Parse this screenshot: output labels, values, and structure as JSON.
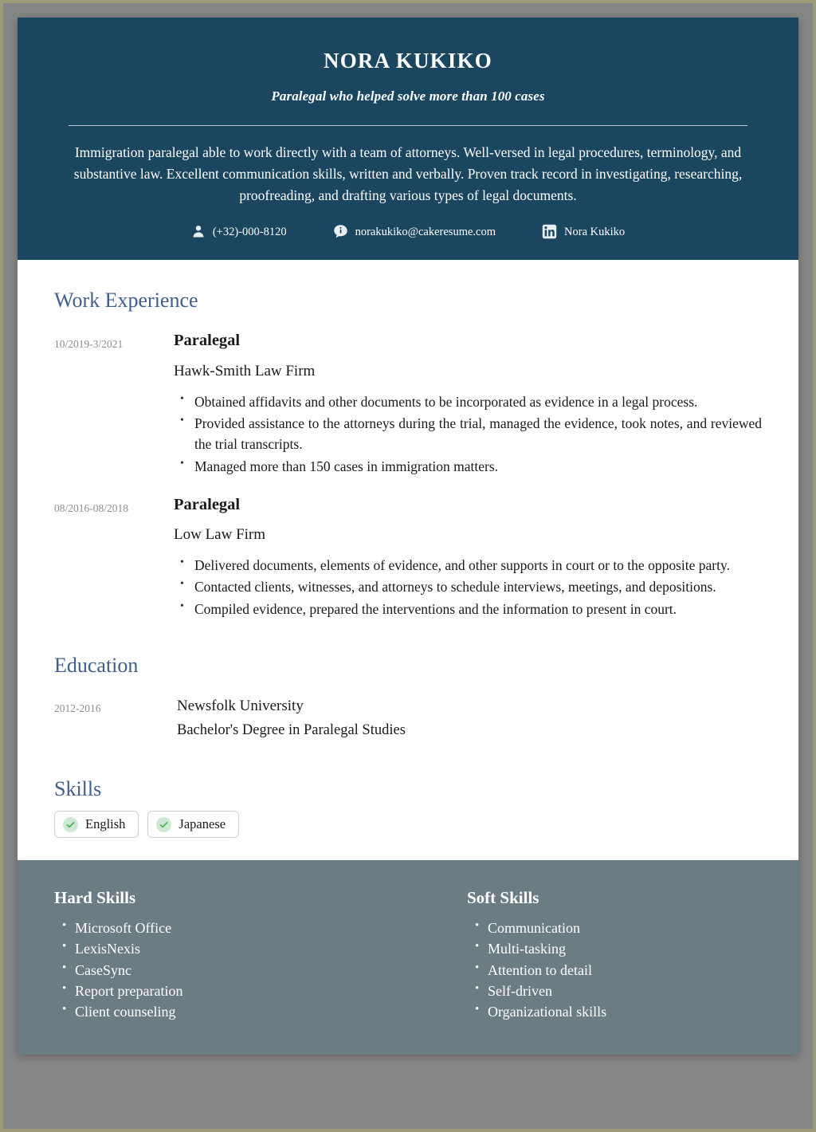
{
  "theme": {
    "header_bg": "#1b4660",
    "footer_bg": "#6c7c83",
    "page_bg": "#ffffff",
    "canvas_bg": "#868686",
    "frame": "#9d9a77",
    "heading_accent": "#3f5f8c",
    "date_text": "#8e8e8e",
    "check_circle_bg": "#cfe8d3",
    "check_mark": "#4caf50"
  },
  "header": {
    "full_name": "NORA KUKIKO",
    "tagline": "Paralegal who helped solve more than 100 cases",
    "summary": "Immigration paralegal able to work directly with a team of attorneys. Well-versed in legal procedures, terminology, and substantive law. Excellent communication skills, written and verbally. Proven track record in investigating, researching, proofreading, and drafting various types of legal documents.",
    "contacts": [
      {
        "icon": "person-icon",
        "label": "(+32)-000-8120"
      },
      {
        "icon": "info-bubble-icon",
        "label": "norakukiko@cakeresume.com"
      },
      {
        "icon": "linkedin-icon",
        "label": "Nora Kukiko"
      }
    ]
  },
  "work_experience": {
    "title": "Work Experience",
    "entries": [
      {
        "date": "10/2019-3/2021",
        "job_title": "Paralegal",
        "organization": "Hawk-Smith Law Firm",
        "duties": [
          "Obtained affidavits and other documents to be incorporated as evidence in a legal process.",
          "Provided assistance to the attorneys during the trial, managed the evidence, took notes, and reviewed the trial transcripts.",
          "Managed more than 150 cases in immigration matters."
        ]
      },
      {
        "date": "08/2016-08/2018",
        "job_title": "Paralegal",
        "organization": "Low Law Firm",
        "duties": [
          "Delivered documents, elements of evidence, and other supports in court or to the opposite party.",
          "Contacted clients, witnesses, and attorneys to schedule interviews, meetings, and depositions.",
          "Compiled evidence, prepared the interventions and the information to present in court."
        ]
      }
    ]
  },
  "education": {
    "title": "Education",
    "entries": [
      {
        "date": "2012-2016",
        "school": "Newsfolk University",
        "degree": "Bachelor's Degree in Paralegal Studies"
      }
    ]
  },
  "skills": {
    "title": "Skills",
    "items": [
      {
        "label": "English",
        "icon": "check-circle-icon"
      },
      {
        "label": "Japanese",
        "icon": "check-circle-icon"
      }
    ]
  },
  "footer": {
    "hard_skills": {
      "title": "Hard Skills",
      "items": [
        "Microsoft Office",
        "LexisNexis",
        "CaseSync",
        "Report preparation",
        "Client counseling"
      ]
    },
    "soft_skills": {
      "title": "Soft Skills",
      "items": [
        "Communication",
        "Multi-tasking",
        "Attention to detail",
        "Self-driven",
        "Organizational skills"
      ]
    }
  }
}
